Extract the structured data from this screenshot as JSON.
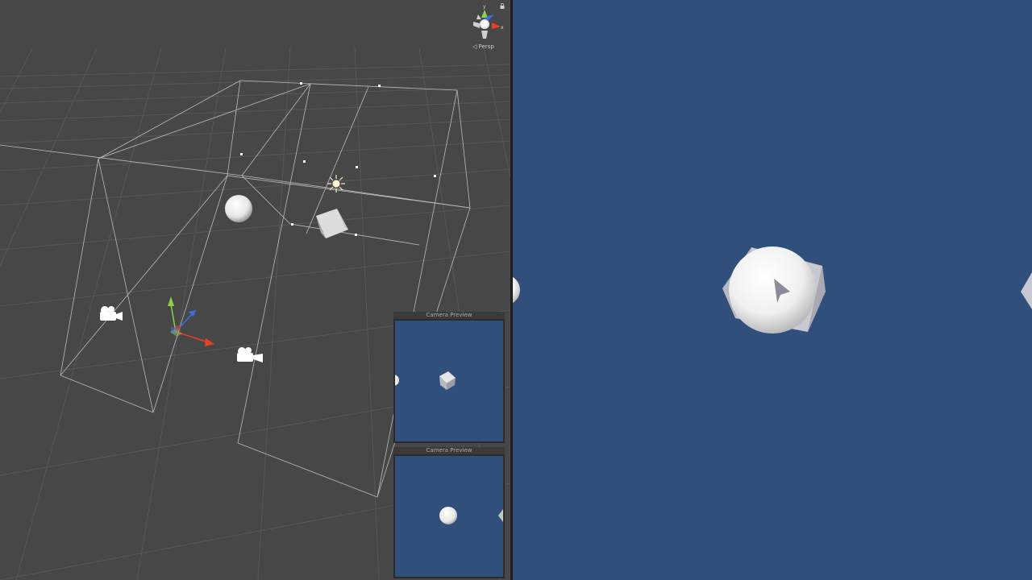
{
  "scene_view": {
    "projection_label": "◁ Persp",
    "gizmo_axes": {
      "y": "y",
      "x": "x"
    }
  },
  "camera_previews": [
    {
      "title": "Camera Preview"
    },
    {
      "title": "Camera Preview"
    }
  ],
  "colors": {
    "scene_background": "#474747",
    "game_background": "#30507b",
    "axis_x": "#e8402a",
    "axis_y": "#8bd14b",
    "axis_z": "#3a6ee8"
  }
}
